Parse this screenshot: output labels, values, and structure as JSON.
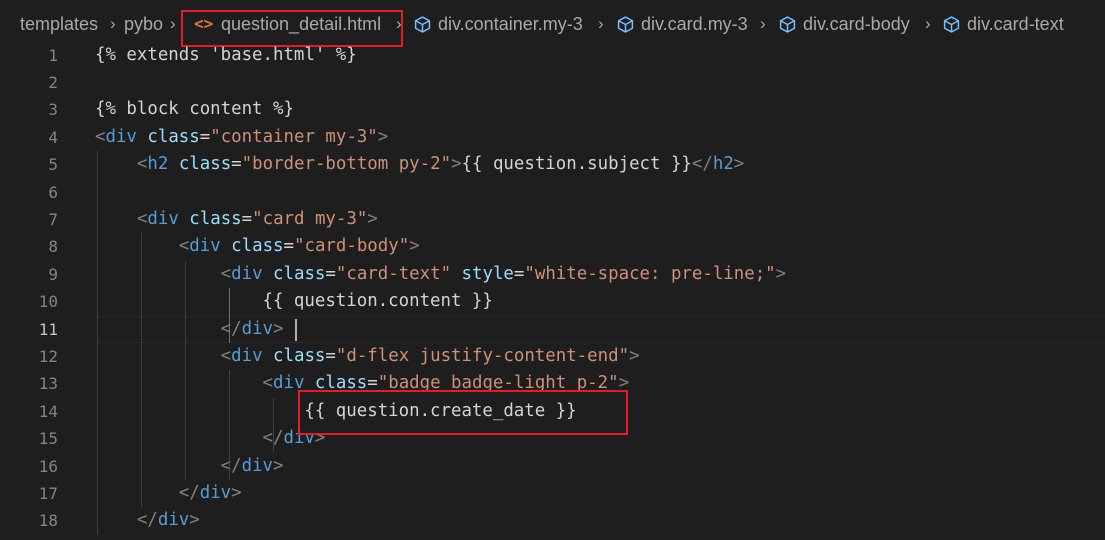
{
  "breadcrumb": {
    "items": [
      "templates",
      "pybo",
      "question_detail.html",
      "div.container.my-3",
      "div.card.my-3",
      "div.card-body",
      "div.card-text"
    ],
    "file_icon": "<>"
  },
  "editor": {
    "active_line": 11,
    "lines": [
      {
        "n": "1",
        "text": "{% extends 'base.html' %}"
      },
      {
        "n": "2",
        "text": ""
      },
      {
        "n": "3",
        "text": "{% block content %}"
      },
      {
        "n": "4",
        "text": "<div class=\"container my-3\">"
      },
      {
        "n": "5",
        "text": "    <h2 class=\"border-bottom py-2\">{{ question.subject }}</h2>"
      },
      {
        "n": "6",
        "text": ""
      },
      {
        "n": "7",
        "text": "    <div class=\"card my-3\">"
      },
      {
        "n": "8",
        "text": "        <div class=\"card-body\">"
      },
      {
        "n": "9",
        "text": "            <div class=\"card-text\" style=\"white-space: pre-line;\">"
      },
      {
        "n": "10",
        "text": "                {{ question.content }}"
      },
      {
        "n": "11",
        "text": "            </div>"
      },
      {
        "n": "12",
        "text": "            <div class=\"d-flex justify-content-end\">"
      },
      {
        "n": "13",
        "text": "                <div class=\"badge badge-light p-2\">"
      },
      {
        "n": "14",
        "text": "                    {{ question.create_date }}"
      },
      {
        "n": "15",
        "text": "                </div>"
      },
      {
        "n": "16",
        "text": "            </div>"
      },
      {
        "n": "17",
        "text": "        </div>"
      },
      {
        "n": "18",
        "text": "    </div>"
      }
    ]
  },
  "colors": {
    "background": "#1e1e1e",
    "tag": "#569cd6",
    "attribute": "#9cdcfe",
    "string": "#ce9178",
    "highlight_box": "#e51c23"
  }
}
